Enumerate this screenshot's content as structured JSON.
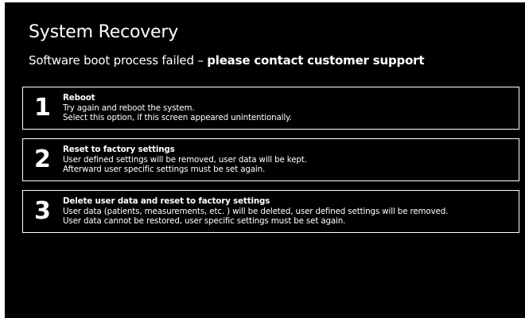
{
  "title": "System Recovery",
  "message": {
    "prefix": "Software boot process failed – ",
    "emphasis": "please contact customer support"
  },
  "options": [
    {
      "number": "1",
      "heading": "Reboot",
      "lines": [
        "Try again and reboot the system.",
        "Select this option, if this screen appeared unintentionally."
      ]
    },
    {
      "number": "2",
      "heading": "Reset to factory settings",
      "lines": [
        "User defined settings will be removed, user data will be kept.",
        "Afterward user specific settings must be set again."
      ]
    },
    {
      "number": "3",
      "heading": "Delete user data and reset to factory settings",
      "lines": [
        "User data (patients, measurements, etc. ) will be deleted, user defined settings will be removed.",
        "User data cannot be restored, user specific settings must be set again."
      ]
    }
  ],
  "colors": {
    "background": "#000000",
    "foreground": "#ffffff",
    "border": "#ffffff"
  }
}
